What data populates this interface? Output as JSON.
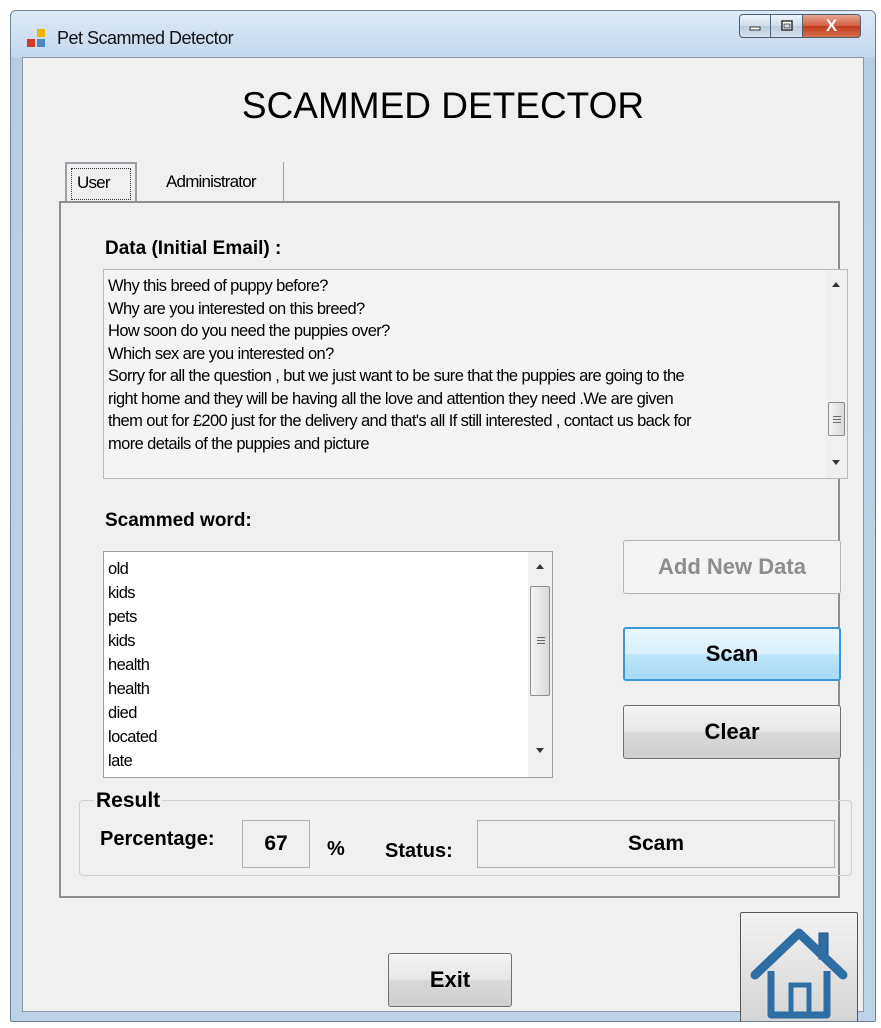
{
  "window": {
    "title": "Pet Scammed Detector",
    "close_glyph": "X"
  },
  "heading": "SCAMMED DETECTOR",
  "tabs": [
    {
      "label": "User",
      "selected": true
    },
    {
      "label": "Administrator",
      "selected": false
    }
  ],
  "email": {
    "label": "Data (Initial Email) :",
    "lines": [
      "Why this breed of puppy before?",
      "Why are you interested on this breed?",
      "How soon do you need the puppies over?",
      "Which sex are you interested on?",
      "Sorry for all the question , but we just want to be sure that the puppies are going to the",
      "right home and they will be having all the love and attention they need .We are given",
      "them out for £200 just for the delivery and that's all If still interested , contact us back for",
      "more details of the puppies and picture"
    ]
  },
  "scammed_words": {
    "label": "Scammed word:",
    "items": [
      "old",
      "kids",
      "pets",
      "kids",
      "health",
      "health",
      "died",
      "located",
      "late"
    ]
  },
  "buttons": {
    "add_new_data": "Add New Data",
    "scan": "Scan",
    "clear": "Clear",
    "exit": "Exit"
  },
  "result": {
    "legend": "Result",
    "percentage_label": "Percentage:",
    "percentage_value": "67",
    "percent_sign": "%",
    "status_label": "Status:",
    "status_value": "Scam"
  },
  "colors": {
    "accent_focus": "#3c97d8",
    "house_blue": "#2f6ea5",
    "close_red": "#c33b1c"
  },
  "icons": {
    "home": "home-icon",
    "app": "app-icon"
  }
}
